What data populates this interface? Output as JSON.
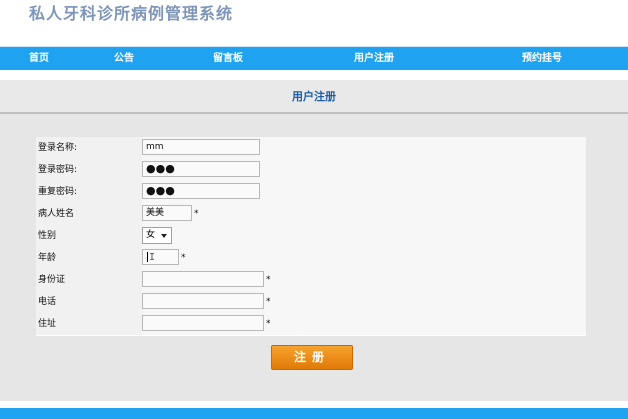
{
  "header": {
    "title": "私人牙科诊所病例管理系统"
  },
  "nav": {
    "items": [
      {
        "label": "首页"
      },
      {
        "label": "公告"
      },
      {
        "label": "留言板"
      },
      {
        "label": "用户注册"
      },
      {
        "label": "预约挂号"
      }
    ]
  },
  "page": {
    "title": "用户注册"
  },
  "form": {
    "username_label": "登录名称:",
    "username_value": "mm",
    "password_label": "登录密码:",
    "password_value": "●●●",
    "confirm_label": "重复密码:",
    "confirm_value": "●●●",
    "name_label": "病人姓名",
    "name_value": "美美",
    "gender_label": "性别",
    "gender_value": "女",
    "age_label": "年龄",
    "age_value": "",
    "idcard_label": "身份证",
    "idcard_value": "",
    "phone_label": "电话",
    "phone_value": "",
    "address_label": "住址",
    "address_value": "",
    "required_mark": "*"
  },
  "actions": {
    "submit_label": "注册"
  },
  "colors": {
    "nav_bg": "#1fa3f0",
    "title_color": "#8096b8",
    "page_title_color": "#1f5fa8",
    "button": "#f29418"
  }
}
